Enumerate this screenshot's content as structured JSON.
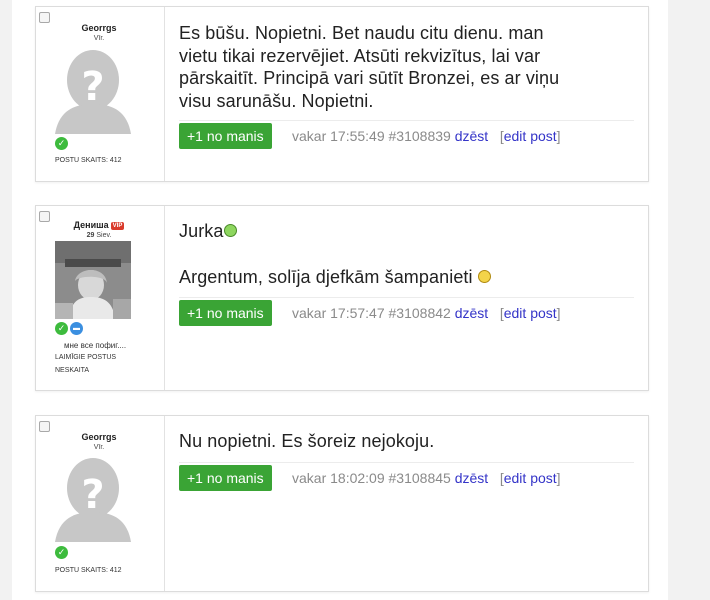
{
  "posts": [
    {
      "author": {
        "name": "Georrgs",
        "gender_age": "Vīr.",
        "posts_label": "POSTU SKAITS: 412",
        "verified_icon": "check-circle-icon"
      },
      "message_lines": [
        "Es būšu. Nopietni. Bet naudu citu dienu. man",
        "vietu tikai rezervējiet. Atsūti rekvizītus, lai var",
        "pārskaitīt. Principā vari sūtīt Bronzei, es ar viņu",
        "visu sarunāšu. Nopietni."
      ],
      "plus_label": "+1 no manis",
      "meta": "vakar 17:55:49 #3108839",
      "delete_label": "dzēst",
      "edit_label": "edit post"
    },
    {
      "author": {
        "name": "Дениша",
        "vip_badge": "VIP",
        "age_num": "29",
        "age_word": "Siev.",
        "status_text": "мне все пофиг....",
        "posts_label_1": "LAIMĪGIE POSTUS",
        "posts_label_2": "NESKAITA",
        "verified_icon": "check-circle-icon",
        "chat_icon": "chat-bubble-icon"
      },
      "title_text": "Jurka",
      "message_lines": [
        "Argentum, solīja djefkām šampanieti"
      ],
      "plus_label": "+1 no manis",
      "meta": "vakar 17:57:47 #3108842",
      "delete_label": "dzēst",
      "edit_label": "edit post"
    },
    {
      "author": {
        "name": "Georrgs",
        "gender_age": "Vīr.",
        "posts_label": "POSTU SKAITS: 412",
        "verified_icon": "check-circle-icon"
      },
      "message_lines": [
        "Nu nopietni. Es šoreiz nejokoju."
      ],
      "plus_label": "+1 no manis",
      "meta": "vakar 18:02:09 #3108845",
      "delete_label": "dzēst",
      "edit_label": "edit post"
    }
  ],
  "colors": {
    "plus_button": "#3aa435",
    "link": "#3434c8",
    "meta_text": "#8a8a8a",
    "verified": "#3dbb3d",
    "chat": "#3b8fe0",
    "vip": "#d93a2b"
  }
}
